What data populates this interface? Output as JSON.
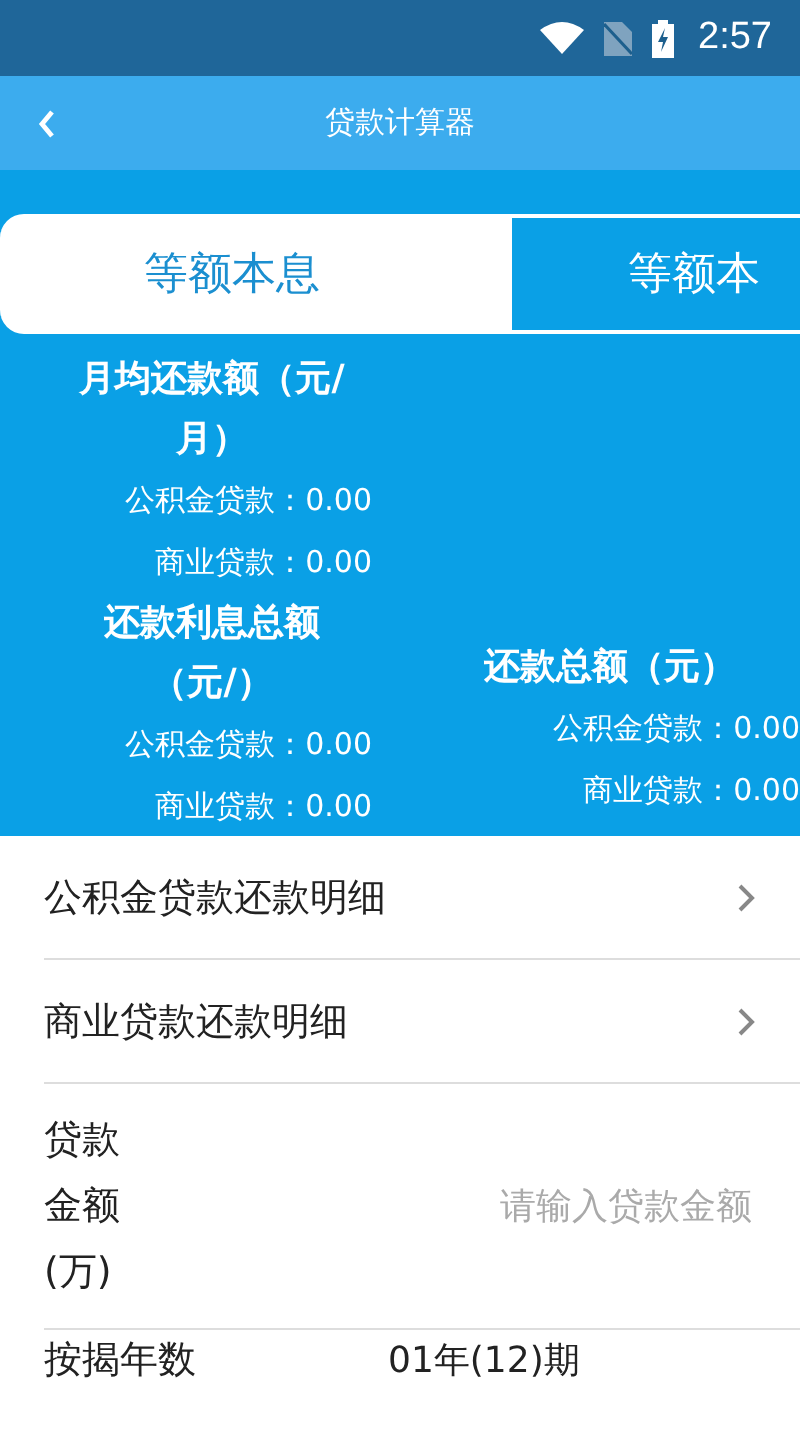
{
  "status_bar": {
    "time": "2:57"
  },
  "header": {
    "title": "贷款计算器"
  },
  "tabs": [
    {
      "label": "等额本息",
      "selected": true
    },
    {
      "label": "等额本",
      "selected": false
    }
  ],
  "summary": [
    {
      "title": "月均还款额（元/月）",
      "lines": [
        "公积金贷款：0.00",
        "商业贷款：0.00"
      ]
    },
    {
      "title": "还款利息总额（元/）",
      "lines": [
        "公积金贷款：0.00",
        "商业贷款：0.00"
      ]
    },
    {
      "title": "还款总额（元）",
      "lines": [
        "公积金贷款：0.00",
        "商业贷款：0.00"
      ]
    }
  ],
  "details": [
    {
      "label": "公积金贷款还款明细"
    },
    {
      "label": "商业贷款还款明细"
    }
  ],
  "form": [
    {
      "kind": "input",
      "label": "贷款金额(万)",
      "placeholder": "请输入贷款金额"
    },
    {
      "kind": "value",
      "label": "按揭年数",
      "value": "01年(12)期"
    }
  ]
}
